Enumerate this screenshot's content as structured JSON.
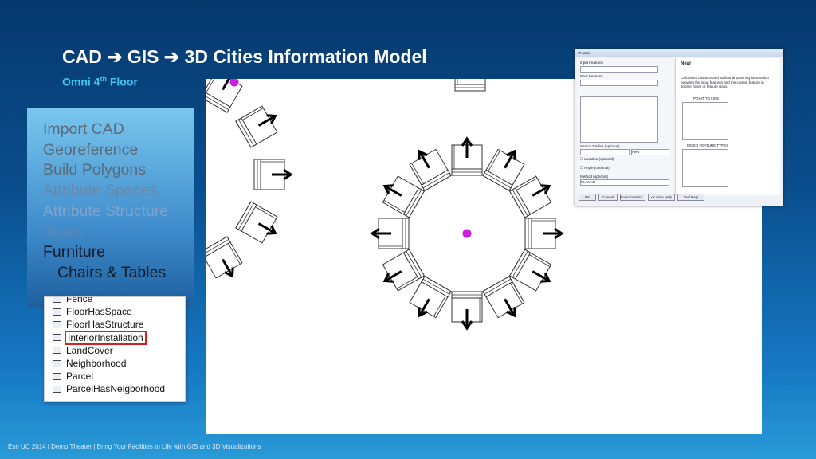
{
  "slide": {
    "title": "CAD ➔ GIS ➔ 3D Cities Information Model",
    "subtitle_main": "Omni 4",
    "subtitle_sup": "th",
    "subtitle_rest": " Floor",
    "footer": "Esri UC 2014 | Demo Theater |  Bring Your Facilities to Life with GIS and 3D Visualizations"
  },
  "steps": [
    "Import CAD",
    "Georeference",
    "Build Polygons",
    "Attribute Spaces",
    "Attribute Structure",
    "Stairs",
    "Furniture",
    "Chairs & Tables"
  ],
  "layers": [
    {
      "label": "Fence"
    },
    {
      "label": "FloorHasSpace"
    },
    {
      "label": "FloorHasStructure"
    },
    {
      "label": "InteriorInstallation",
      "selected": true
    },
    {
      "label": "LandCover"
    },
    {
      "label": "Neighborhood"
    },
    {
      "label": "Parcel"
    },
    {
      "label": "ParcelHasNeigborhood"
    }
  ],
  "tool": {
    "window_title": "Near",
    "input_features_label": "Input Features",
    "near_features_label": "Near Features",
    "search_radius_label": "Search Radius (optional)",
    "units_value": "Feet",
    "location_label": "Location (optional)",
    "angle_label": "Angle (optional)",
    "method_label": "Method (optional)",
    "method_value": "PLANAR",
    "ok": "OK",
    "cancel": "Cancel",
    "environments": "Environments...",
    "hide_help": "<< Hide Help",
    "tool_help": "Tool Help",
    "help_title": "Near",
    "help_text": "Calculates distance and additional proximity information between the input features and the closest feature in another layer or feature class.",
    "fig1_title": "POINT TO LINE",
    "fig2_title": "MIXED FEATURE TYPES"
  },
  "colors": {
    "point": "#cc1ee0",
    "arrow": "#000000"
  }
}
